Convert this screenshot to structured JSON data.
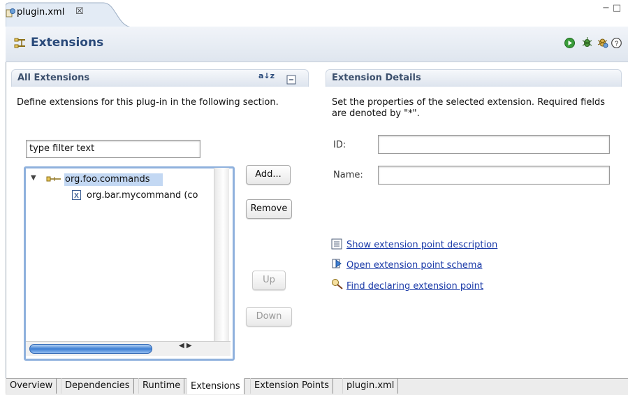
{
  "editor_tab": {
    "label": "plugin.xml",
    "close_glyph": "☒",
    "icon": "plugin-file-icon"
  },
  "window_controls": {
    "minimize": "−",
    "maximize": "□"
  },
  "header": {
    "title": "Extensions",
    "icon": "extensions-icon",
    "actions": [
      "run-icon",
      "debug-icon",
      "plugin-debug-icon",
      "help-icon"
    ],
    "help_glyph": "?"
  },
  "all_extensions": {
    "title": "All Extensions",
    "sort_label": "a↓z",
    "description": "Define extensions for this plug-in in the following section.",
    "filter_placeholder": "type filter text",
    "filter_value": "type filter text",
    "tree": [
      {
        "label": "org.foo.commands",
        "expanded": true,
        "selected": true,
        "children": [
          {
            "label": "org.bar.mycommand (co"
          }
        ]
      }
    ],
    "buttons": {
      "add": "Add...",
      "remove": "Remove",
      "up": "Up",
      "down": "Down"
    }
  },
  "extension_details": {
    "title": "Extension Details",
    "description": "Set the properties of the selected extension. Required fields are denoted by \"*\".",
    "id_label": "ID:",
    "id_value": "",
    "name_label": "Name:",
    "name_value": "",
    "links": [
      {
        "label": "Show extension point description",
        "icon": "description-icon"
      },
      {
        "label": "Open extension point schema",
        "icon": "schema-icon"
      },
      {
        "label": "Find declaring extension point",
        "icon": "find-icon"
      }
    ]
  },
  "bottom_tabs": [
    {
      "label": "Overview",
      "active": false
    },
    {
      "label": "Dependencies",
      "active": false
    },
    {
      "label": "Runtime",
      "active": false
    },
    {
      "label": "Extensions",
      "active": true
    },
    {
      "label": "Extension Points",
      "active": false
    },
    {
      "label": "plugin.xml",
      "active": false
    }
  ],
  "colors": {
    "accent": "#3e7fd3",
    "selection": "#c3d8f3",
    "title": "#2a4a7a",
    "link": "#1a3aa8"
  }
}
